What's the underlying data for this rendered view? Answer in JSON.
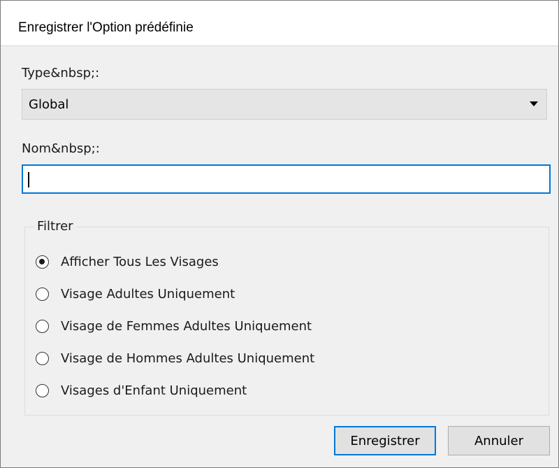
{
  "dialog": {
    "title": "Enregistrer l'Option prédéfinie"
  },
  "type_field": {
    "label": "Type&nbsp;:",
    "selected": "Global"
  },
  "name_field": {
    "label": "Nom&nbsp;:",
    "value": ""
  },
  "filter": {
    "legend": "Filtrer",
    "options": [
      {
        "label": "Afficher Tous Les Visages",
        "checked": true
      },
      {
        "label": "Visage Adultes Uniquement",
        "checked": false
      },
      {
        "label": "Visage de Femmes Adultes Uniquement",
        "checked": false
      },
      {
        "label": "Visage de Hommes Adultes Uniquement",
        "checked": false
      },
      {
        "label": "Visages d'Enfant Uniquement",
        "checked": false
      }
    ]
  },
  "buttons": {
    "save": "Enregistrer",
    "cancel": "Annuler"
  },
  "colors": {
    "accent": "#0078d7",
    "dialog_bg": "#f0f0f0"
  }
}
